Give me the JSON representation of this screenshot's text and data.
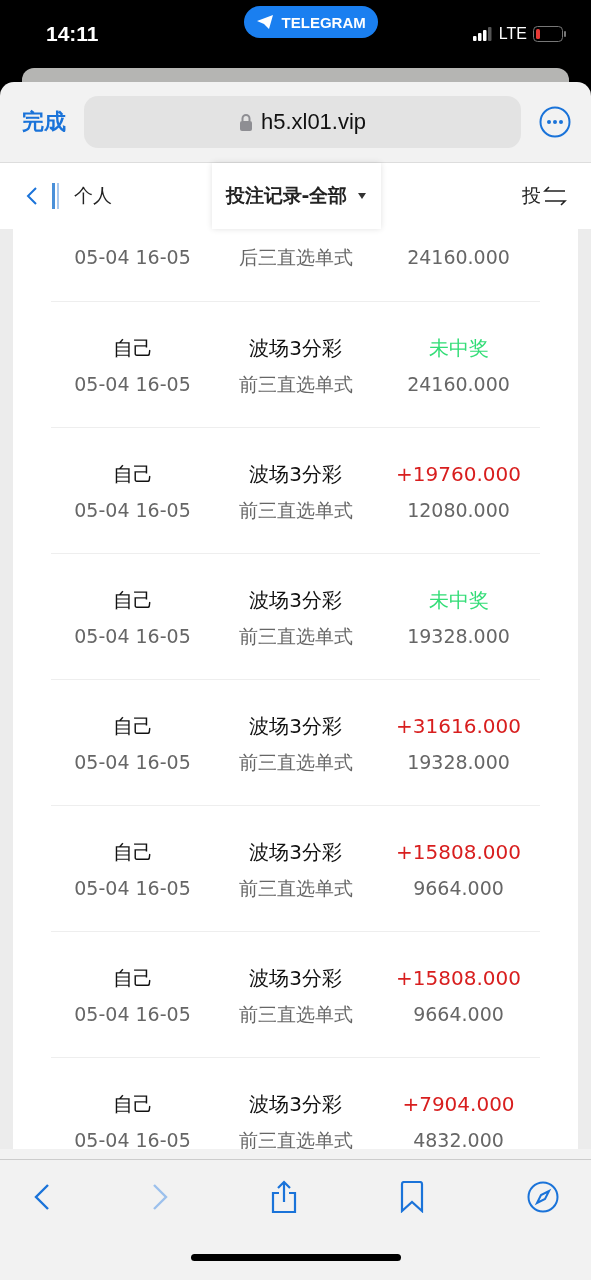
{
  "status_bar": {
    "time": "14:11",
    "app_pill": "TELEGRAM",
    "network": "LTE"
  },
  "browser": {
    "done": "完成",
    "url": "h5.xl01.vip"
  },
  "header": {
    "back_label": "个人",
    "title": "投注记录-全部",
    "right_label": "投"
  },
  "rows": [
    {
      "kind": "partial",
      "date": "05-04 16-05",
      "play": "后三直选单式",
      "amount": "24160.000"
    },
    {
      "kind": "full",
      "who": "自己",
      "date": "05-04 16-05",
      "lottery": "波场3分彩",
      "play": "前三直选单式",
      "result": {
        "kind": "lose",
        "text": "未中奖"
      },
      "amount": "24160.000"
    },
    {
      "kind": "full",
      "who": "自己",
      "date": "05-04 16-05",
      "lottery": "波场3分彩",
      "play": "前三直选单式",
      "result": {
        "kind": "win",
        "text": "+19760.000"
      },
      "amount": "12080.000"
    },
    {
      "kind": "full",
      "who": "自己",
      "date": "05-04 16-05",
      "lottery": "波场3分彩",
      "play": "前三直选单式",
      "result": {
        "kind": "lose",
        "text": "未中奖"
      },
      "amount": "19328.000"
    },
    {
      "kind": "full",
      "who": "自己",
      "date": "05-04 16-05",
      "lottery": "波场3分彩",
      "play": "前三直选单式",
      "result": {
        "kind": "win",
        "text": "+31616.000"
      },
      "amount": "19328.000"
    },
    {
      "kind": "full",
      "who": "自己",
      "date": "05-04 16-05",
      "lottery": "波场3分彩",
      "play": "前三直选单式",
      "result": {
        "kind": "win",
        "text": "+15808.000"
      },
      "amount": "9664.000"
    },
    {
      "kind": "full",
      "who": "自己",
      "date": "05-04 16-05",
      "lottery": "波场3分彩",
      "play": "前三直选单式",
      "result": {
        "kind": "win",
        "text": "+15808.000"
      },
      "amount": "9664.000"
    },
    {
      "kind": "full",
      "who": "自己",
      "date": "05-04 16-05",
      "lottery": "波场3分彩",
      "play": "前三直选单式",
      "result": {
        "kind": "win",
        "text": "+7904.000"
      },
      "amount": "4832.000"
    }
  ]
}
